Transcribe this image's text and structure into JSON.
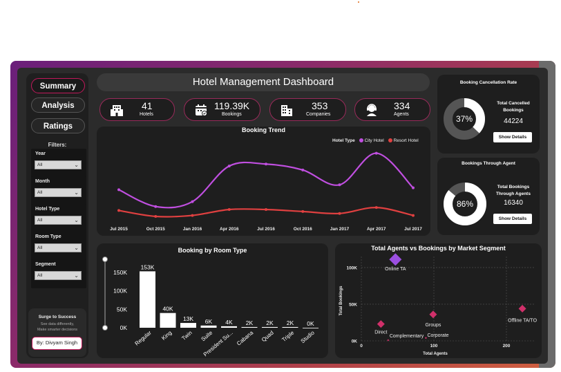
{
  "nav": {
    "items": [
      {
        "label": "Summary",
        "active": true
      },
      {
        "label": "Analysis",
        "active": false
      },
      {
        "label": "Ratings",
        "active": false
      }
    ]
  },
  "filters": {
    "title": "Filters:",
    "items": [
      {
        "label": "Year",
        "value": "All"
      },
      {
        "label": "Month",
        "value": "All"
      },
      {
        "label": "Hotel Type",
        "value": "All"
      },
      {
        "label": "Room Type",
        "value": "All"
      },
      {
        "label": "Segment",
        "value": "All"
      }
    ]
  },
  "promo": {
    "title": "Surge to Success",
    "line1": "See data differently,",
    "line2": "Make smarter decisions",
    "author": "By: Divyam Singh"
  },
  "header": {
    "title": "Hotel Management Dashboard"
  },
  "kpis": [
    {
      "icon": "hotel-icon",
      "value": "41",
      "label": "Hotels"
    },
    {
      "icon": "calendar-check-icon",
      "value": "119.39K",
      "label": "Bookings"
    },
    {
      "icon": "building-icon",
      "value": "353",
      "label": "Companies"
    },
    {
      "icon": "agent-headset-icon",
      "value": "334",
      "label": "Agents"
    }
  ],
  "cancellation": {
    "title": "Booking Cancellation Rate",
    "percent_label": "37%",
    "percent": 37,
    "label_line1": "Total Cancelled",
    "label_line2": "Bookings",
    "value": "44224",
    "button": "Show Details"
  },
  "agent_share": {
    "title": "Bookings Through Agent",
    "percent_label": "86%",
    "percent": 86,
    "label_line1": "Total Bookings",
    "label_line2": "Through Agents",
    "value": "16340",
    "button": "Show Details"
  },
  "colors": {
    "city": "#c04fe0",
    "resort": "#e04040",
    "bar": "#ffffff",
    "scatter_marker": "#d0306a",
    "scatter_highlight": "#9b4fe0",
    "accent": "#c2185b"
  },
  "chart_data": [
    {
      "type": "line",
      "title": "Booking Trend",
      "legend_title": "Hotel Type",
      "legend_position": "top-right",
      "x": [
        "Jul 2015",
        "Oct 2015",
        "Jan 2016",
        "Apr 2016",
        "Jul 2016",
        "Oct 2016",
        "Jan 2017",
        "Apr 2017",
        "Jul 2017"
      ],
      "series": [
        {
          "name": "City Hotel",
          "values": [
            5200,
            3500,
            4000,
            7600,
            7800,
            7200,
            5700,
            8900,
            5400
          ]
        },
        {
          "name": "Resort Hotel",
          "values": [
            3100,
            2500,
            2600,
            3200,
            3200,
            3000,
            2800,
            3400,
            2600
          ]
        }
      ],
      "ylim": [
        1800,
        9500
      ],
      "grid": false
    },
    {
      "type": "bar",
      "title": "Booking by Room Type",
      "categories": [
        "Regular",
        "King",
        "Twin",
        "Suite",
        "President Su...",
        "Cabana",
        "Quad",
        "Triple",
        "Studio"
      ],
      "values": [
        153000,
        40000,
        13000,
        6000,
        4000,
        2000,
        2000,
        2000,
        0
      ],
      "value_labels": [
        "153K",
        "40K",
        "13K",
        "6K",
        "4K",
        "2K",
        "2K",
        "2K",
        "0K"
      ],
      "yticks": [
        "0K",
        "50K",
        "100K",
        "150K"
      ],
      "ylim": [
        0,
        150000
      ]
    },
    {
      "type": "scatter",
      "title": "Total Agents vs Bookings by Market Segment",
      "xlabel": "Total Agents",
      "ylabel": "Total Bookings",
      "xticks": [
        "0",
        "100",
        "200"
      ],
      "yticks": [
        "0K",
        "50K",
        "100K"
      ],
      "xlim": [
        0,
        240
      ],
      "ylim": [
        0,
        115000
      ],
      "points": [
        {
          "label": "Online TA",
          "x": 47,
          "y": 111000,
          "highlight": true
        },
        {
          "label": "Offline TA/TO",
          "x": 222,
          "y": 44000,
          "highlight": false
        },
        {
          "label": "Groups",
          "x": 99,
          "y": 36000,
          "highlight": false
        },
        {
          "label": "Direct",
          "x": 27,
          "y": 23000,
          "highlight": false
        },
        {
          "label": "Corporate",
          "x": 89,
          "y": 4000,
          "highlight": false
        },
        {
          "label": "Complementary",
          "x": 37,
          "y": 1000,
          "highlight": false
        }
      ],
      "grid": true
    }
  ]
}
